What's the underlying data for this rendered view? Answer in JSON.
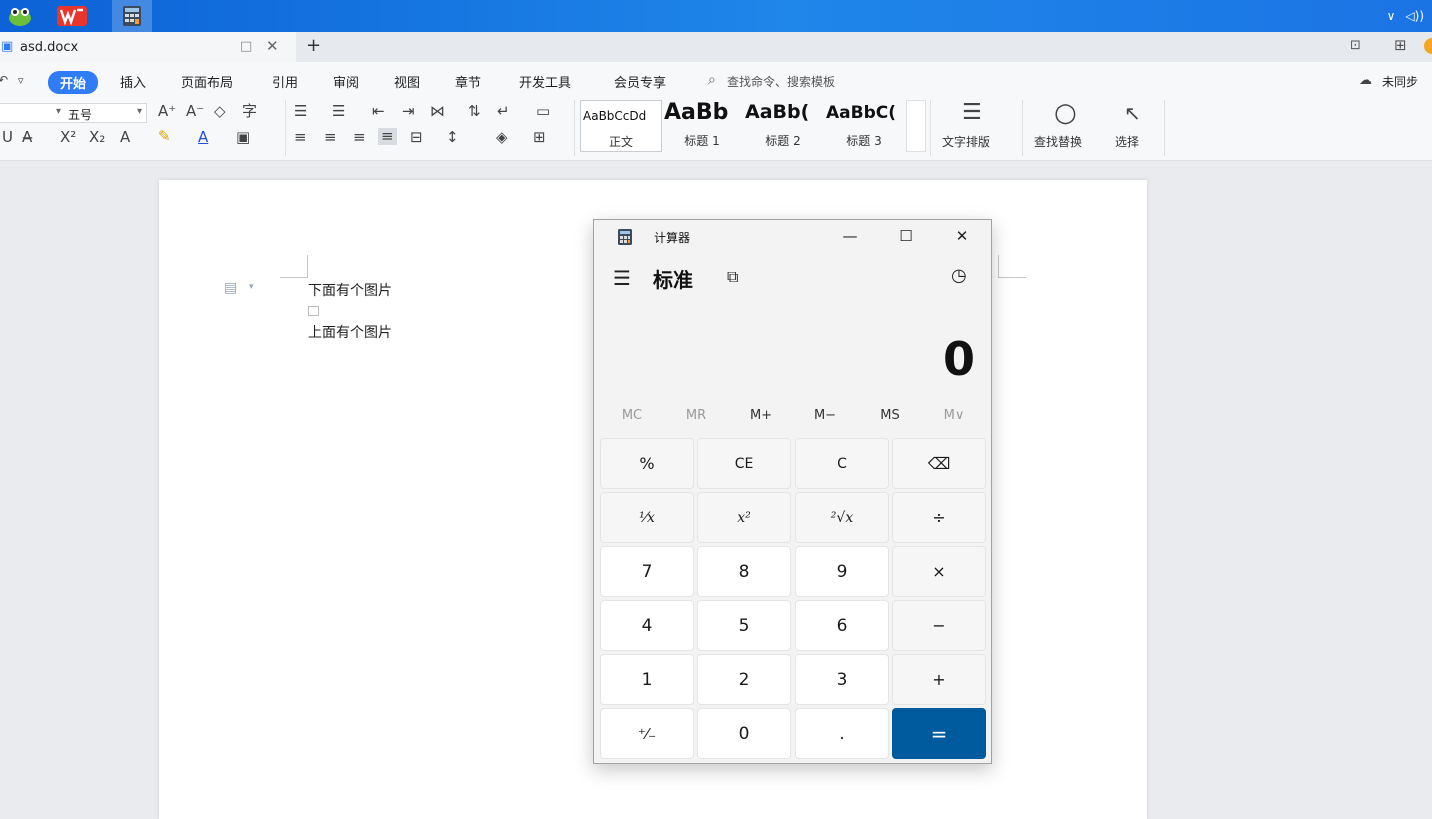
{
  "taskbar": {
    "apps": [
      {
        "name": "app-frog-icon"
      },
      {
        "name": "wps-office-icon"
      },
      {
        "name": "calculator-app-icon"
      }
    ],
    "tray": {
      "chevron": "∨",
      "volume": "◁))"
    }
  },
  "tabbar": {
    "doc_tab_label": "asd.docx",
    "new_tab": "+"
  },
  "ribbon": {
    "menu": {
      "home": "开始",
      "insert": "插入",
      "page_layout": "页面布局",
      "references": "引用",
      "review": "审阅",
      "view": "视图",
      "chapter": "章节",
      "developer": "开发工具",
      "member": "会员专享",
      "search": "查找命令、搜索模板",
      "sync": "未同步"
    },
    "font_size": "五号",
    "styles": [
      {
        "sample": "AaBbCcDd",
        "name": "正文"
      },
      {
        "sample": "AaBb",
        "name": "标题 1"
      },
      {
        "sample": "AaBb(",
        "name": "标题 2"
      },
      {
        "sample": "AaBbC(",
        "name": "标题 3"
      }
    ],
    "text_layout": "文字排版",
    "find_replace": "查找替换",
    "select": "选择"
  },
  "document": {
    "line1": "下面有个图片",
    "line2": "上面有个图片"
  },
  "calculator": {
    "title": "计算器",
    "mode": "标准",
    "display": "0",
    "memory": [
      "MC",
      "MR",
      "M+",
      "M−",
      "MS",
      "M∨"
    ],
    "keys": {
      "percent": "%",
      "ce": "CE",
      "c": "C",
      "reciprocal": "¹⁄x",
      "square": "x²",
      "sqrt": "²√x",
      "divide": "÷",
      "seven": "7",
      "eight": "8",
      "nine": "9",
      "multiply": "×",
      "four": "4",
      "five": "5",
      "six": "6",
      "minus": "−",
      "one": "1",
      "two": "2",
      "three": "3",
      "plus": "+",
      "negate": "⁺⁄₋",
      "zero": "0",
      "decimal": ".",
      "equals": "="
    }
  },
  "colors": {
    "taskbar": "#1a78e6",
    "home_tab": "#2f7cf6",
    "equals_key": "#005a9e"
  }
}
